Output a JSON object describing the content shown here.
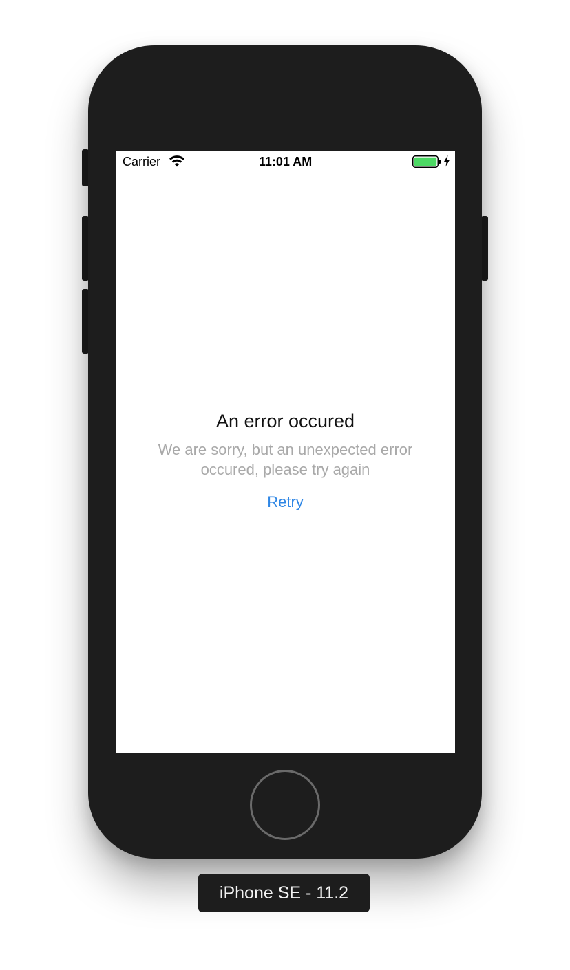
{
  "status_bar": {
    "carrier": "Carrier",
    "time": "11:01 AM",
    "icons": [
      "wifi-icon",
      "battery-icon",
      "charging-icon"
    ],
    "battery_color": "#4cd964"
  },
  "error": {
    "title": "An error occured",
    "message": "We are sorry, but an unexpected error occured, please try again",
    "retry_label": "Retry",
    "retry_color": "#2e86e5"
  },
  "device": {
    "label": "iPhone SE - 11.2"
  }
}
